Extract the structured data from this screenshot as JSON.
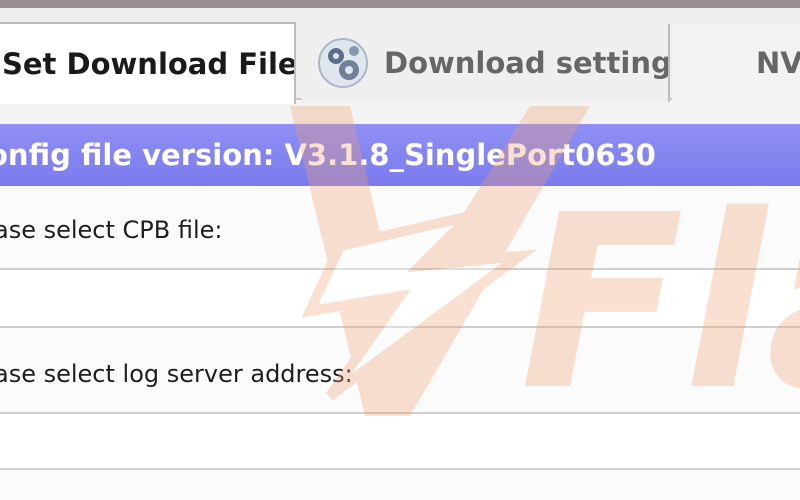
{
  "tabs": {
    "set_download_files": "Set Download Files",
    "download_setting": "Download setting",
    "nv": "NV"
  },
  "banner": {
    "config_version": "onfig file version: V3.1.8_SinglePort0630"
  },
  "form": {
    "cpb_label": "ase select CPB file:",
    "cpb_value": "",
    "log_server_label": "ase select log server address:",
    "log_server_value": ""
  },
  "colors": {
    "banner": "#7b7bee",
    "watermark": "#f0a070"
  },
  "icons": {
    "download_setting_tab": "gear-icon",
    "watermark": "flash-logo-watermark"
  },
  "watermark": {
    "text": "Fla"
  }
}
